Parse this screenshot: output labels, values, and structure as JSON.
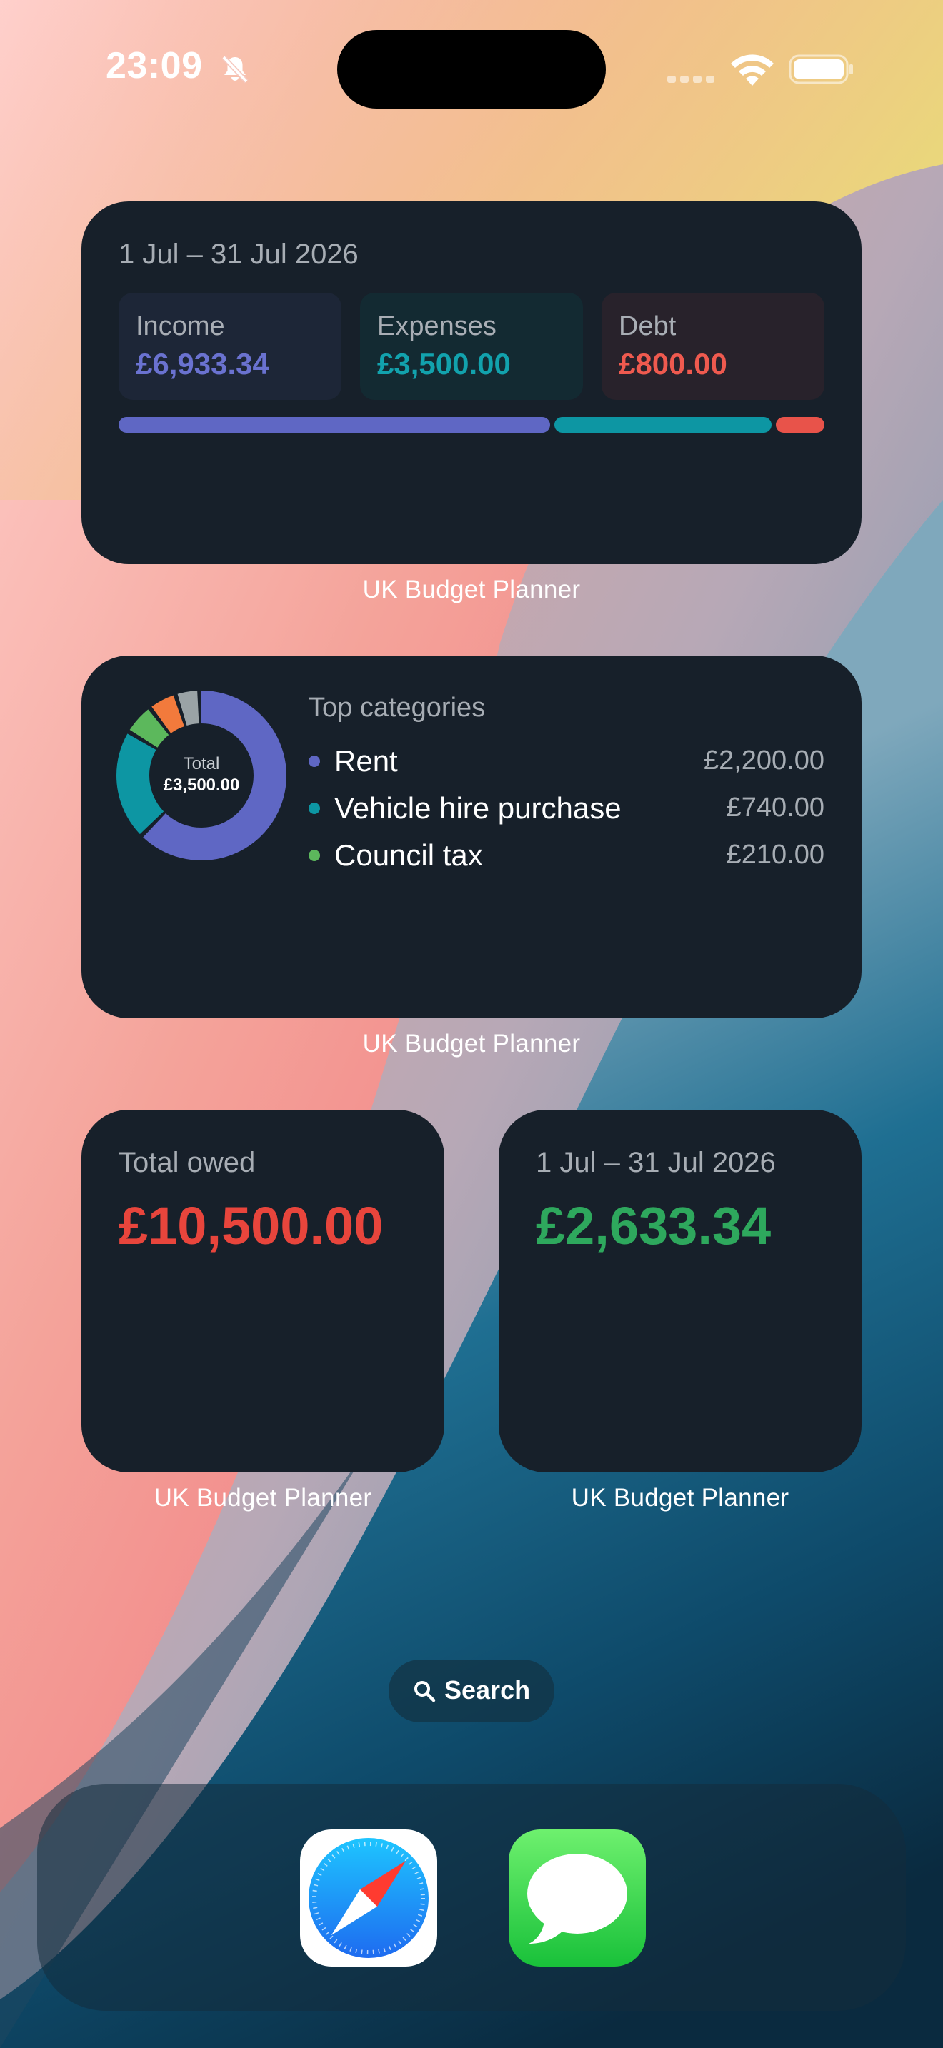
{
  "status_bar": {
    "time": "23:09",
    "icons": [
      "bell-slash-icon",
      "cellular-signal-icon",
      "wifi-icon",
      "battery-icon"
    ]
  },
  "widgets": {
    "summary": {
      "period": "1 Jul – 31 Jul 2026",
      "income_label": "Income",
      "income_value": "£6,933.34",
      "expenses_label": "Expenses",
      "expenses_value": "£3,500.00",
      "debt_label": "Debt",
      "debt_value": "£800.00",
      "bar_shares": {
        "income": 0.6,
        "expenses": 0.3,
        "debt": 0.07
      },
      "colors": {
        "income": "#5f67c4",
        "expenses": "#0d96a3",
        "debt": "#e8534a"
      },
      "caption": "UK Budget Planner"
    },
    "categories": {
      "header": "Top categories",
      "total_label": "Total",
      "total_value": "£3,500.00",
      "items": [
        {
          "name": "Rent",
          "amount": "£2,200.00",
          "color": "#5f67c4"
        },
        {
          "name": "Vehicle hire purchase",
          "amount": "£740.00",
          "color": "#0d96a3"
        },
        {
          "name": "Council tax",
          "amount": "£210.00",
          "color": "#5cb85c"
        }
      ],
      "donut_values": [
        2200,
        740,
        210,
        190,
        160
      ],
      "donut_colors": [
        "#5f67c4",
        "#0d96a3",
        "#5cb85c",
        "#f27a3c",
        "#9aa3a6"
      ],
      "caption": "UK Budget Planner"
    },
    "debt_total": {
      "label": "Total owed",
      "value": "£10,500.00",
      "value_color": "#e8453c",
      "caption": "UK Budget Planner"
    },
    "balance": {
      "period": "1 Jul – 31 Jul 2026",
      "value": "£2,633.34",
      "value_color": "#2ea85d",
      "caption": "UK Budget Planner"
    }
  },
  "search": {
    "label": "Search",
    "icon": "magnifier-icon"
  },
  "dock": {
    "apps": [
      "safari-icon",
      "messages-icon"
    ]
  }
}
